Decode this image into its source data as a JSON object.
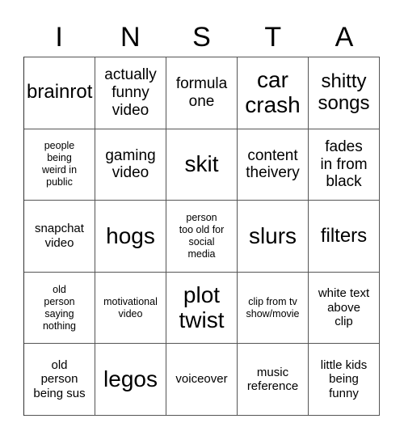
{
  "card": {
    "title_letters": [
      "I",
      "N",
      "S",
      "T",
      "A"
    ],
    "columns": 5,
    "rows": 5,
    "border_color": "#555555",
    "text_color": "#000000",
    "background_color": "#ffffff",
    "cells": [
      {
        "text": "brainrot",
        "size": "lg"
      },
      {
        "text": "actually\nfunny\nvideo",
        "size": "md"
      },
      {
        "text": "formula\none",
        "size": "md"
      },
      {
        "text": "car\ncrash",
        "size": "xl"
      },
      {
        "text": "shitty\nsongs",
        "size": "lg"
      },
      {
        "text": "people\nbeing\nweird in\npublic",
        "size": "xs"
      },
      {
        "text": "gaming\nvideo",
        "size": "md"
      },
      {
        "text": "skit",
        "size": "xl"
      },
      {
        "text": "content\ntheivery",
        "size": "md"
      },
      {
        "text": "fades\nin from\nblack",
        "size": "md"
      },
      {
        "text": "snapchat\nvideo",
        "size": "sm"
      },
      {
        "text": "hogs",
        "size": "xl"
      },
      {
        "text": "person\ntoo old for\nsocial\nmedia",
        "size": "xs"
      },
      {
        "text": "slurs",
        "size": "xl"
      },
      {
        "text": "filters",
        "size": "lg"
      },
      {
        "text": "old\nperson\nsaying\nnothing",
        "size": "xs"
      },
      {
        "text": "motivational\nvideo",
        "size": "xs"
      },
      {
        "text": "plot\ntwist",
        "size": "xl"
      },
      {
        "text": "clip from tv\nshow/movie",
        "size": "xs"
      },
      {
        "text": "white text\nabove\nclip",
        "size": "sm"
      },
      {
        "text": "old\nperson\nbeing sus",
        "size": "sm"
      },
      {
        "text": "legos",
        "size": "xl"
      },
      {
        "text": "voiceover",
        "size": "sm"
      },
      {
        "text": "music\nreference",
        "size": "sm"
      },
      {
        "text": "little kids\nbeing\nfunny",
        "size": "sm"
      }
    ]
  }
}
